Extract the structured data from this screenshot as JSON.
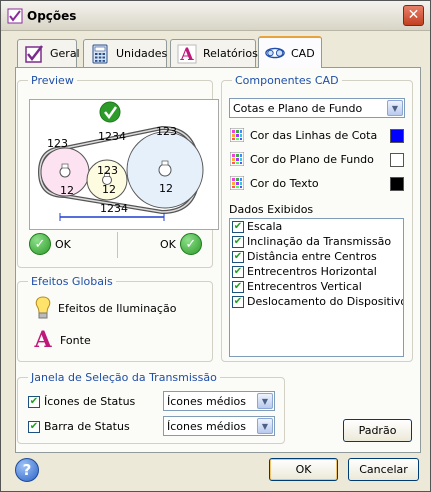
{
  "window": {
    "title": "Opções"
  },
  "tabs": [
    {
      "label": "Geral"
    },
    {
      "label": "Unidades"
    },
    {
      "label": "Relatórios"
    },
    {
      "label": "CAD"
    }
  ],
  "preview": {
    "legend": "Preview",
    "labels": {
      "dim_top_left": "123",
      "dim_top_center": "1234",
      "dim_top_right": "123",
      "small_left": "12",
      "small_center_top": "123",
      "small_center": "12",
      "small_right": "12",
      "bottom_dim": "1234"
    },
    "ok_left": "OK",
    "ok_right": "OK"
  },
  "global_effects": {
    "legend": "Efeitos Globais",
    "lighting": "Efeitos de Iluminação",
    "font": "Fonte"
  },
  "cad_components": {
    "legend": "Componentes CAD",
    "selected": "Cotas e Plano de Fundo",
    "colors": [
      {
        "label": "Cor das Linhas de Cota",
        "color": "#0000ff"
      },
      {
        "label": "Cor do Plano de Fundo",
        "color": "#ffffff"
      },
      {
        "label": "Cor do Texto",
        "color": "#000000"
      }
    ]
  },
  "displayed_data": {
    "label": "Dados Exibidos",
    "items": [
      {
        "label": "Escala",
        "checked": true
      },
      {
        "label": "Inclinação da Transmissão",
        "checked": true
      },
      {
        "label": "Distância entre Centros",
        "checked": true
      },
      {
        "label": "Entrecentros Horizontal",
        "checked": true
      },
      {
        "label": "Entrecentros Vertical",
        "checked": true
      },
      {
        "label": "Deslocamento do Dispositivo Ten",
        "checked": true
      }
    ]
  },
  "transmission_window": {
    "legend": "Janela de Seleção da Transmissão",
    "status_icons": {
      "label": "Ícones de Status",
      "checked": true,
      "value": "Ícones médios"
    },
    "status_bar": {
      "label": "Barra de Status",
      "checked": true,
      "value": "Ícones médios"
    }
  },
  "buttons": {
    "default": "Padrão",
    "ok": "OK",
    "cancel": "Cancelar",
    "help": "?"
  },
  "colors": {
    "accent": "#1f4fa8",
    "ok_green": "#2c9b29"
  }
}
